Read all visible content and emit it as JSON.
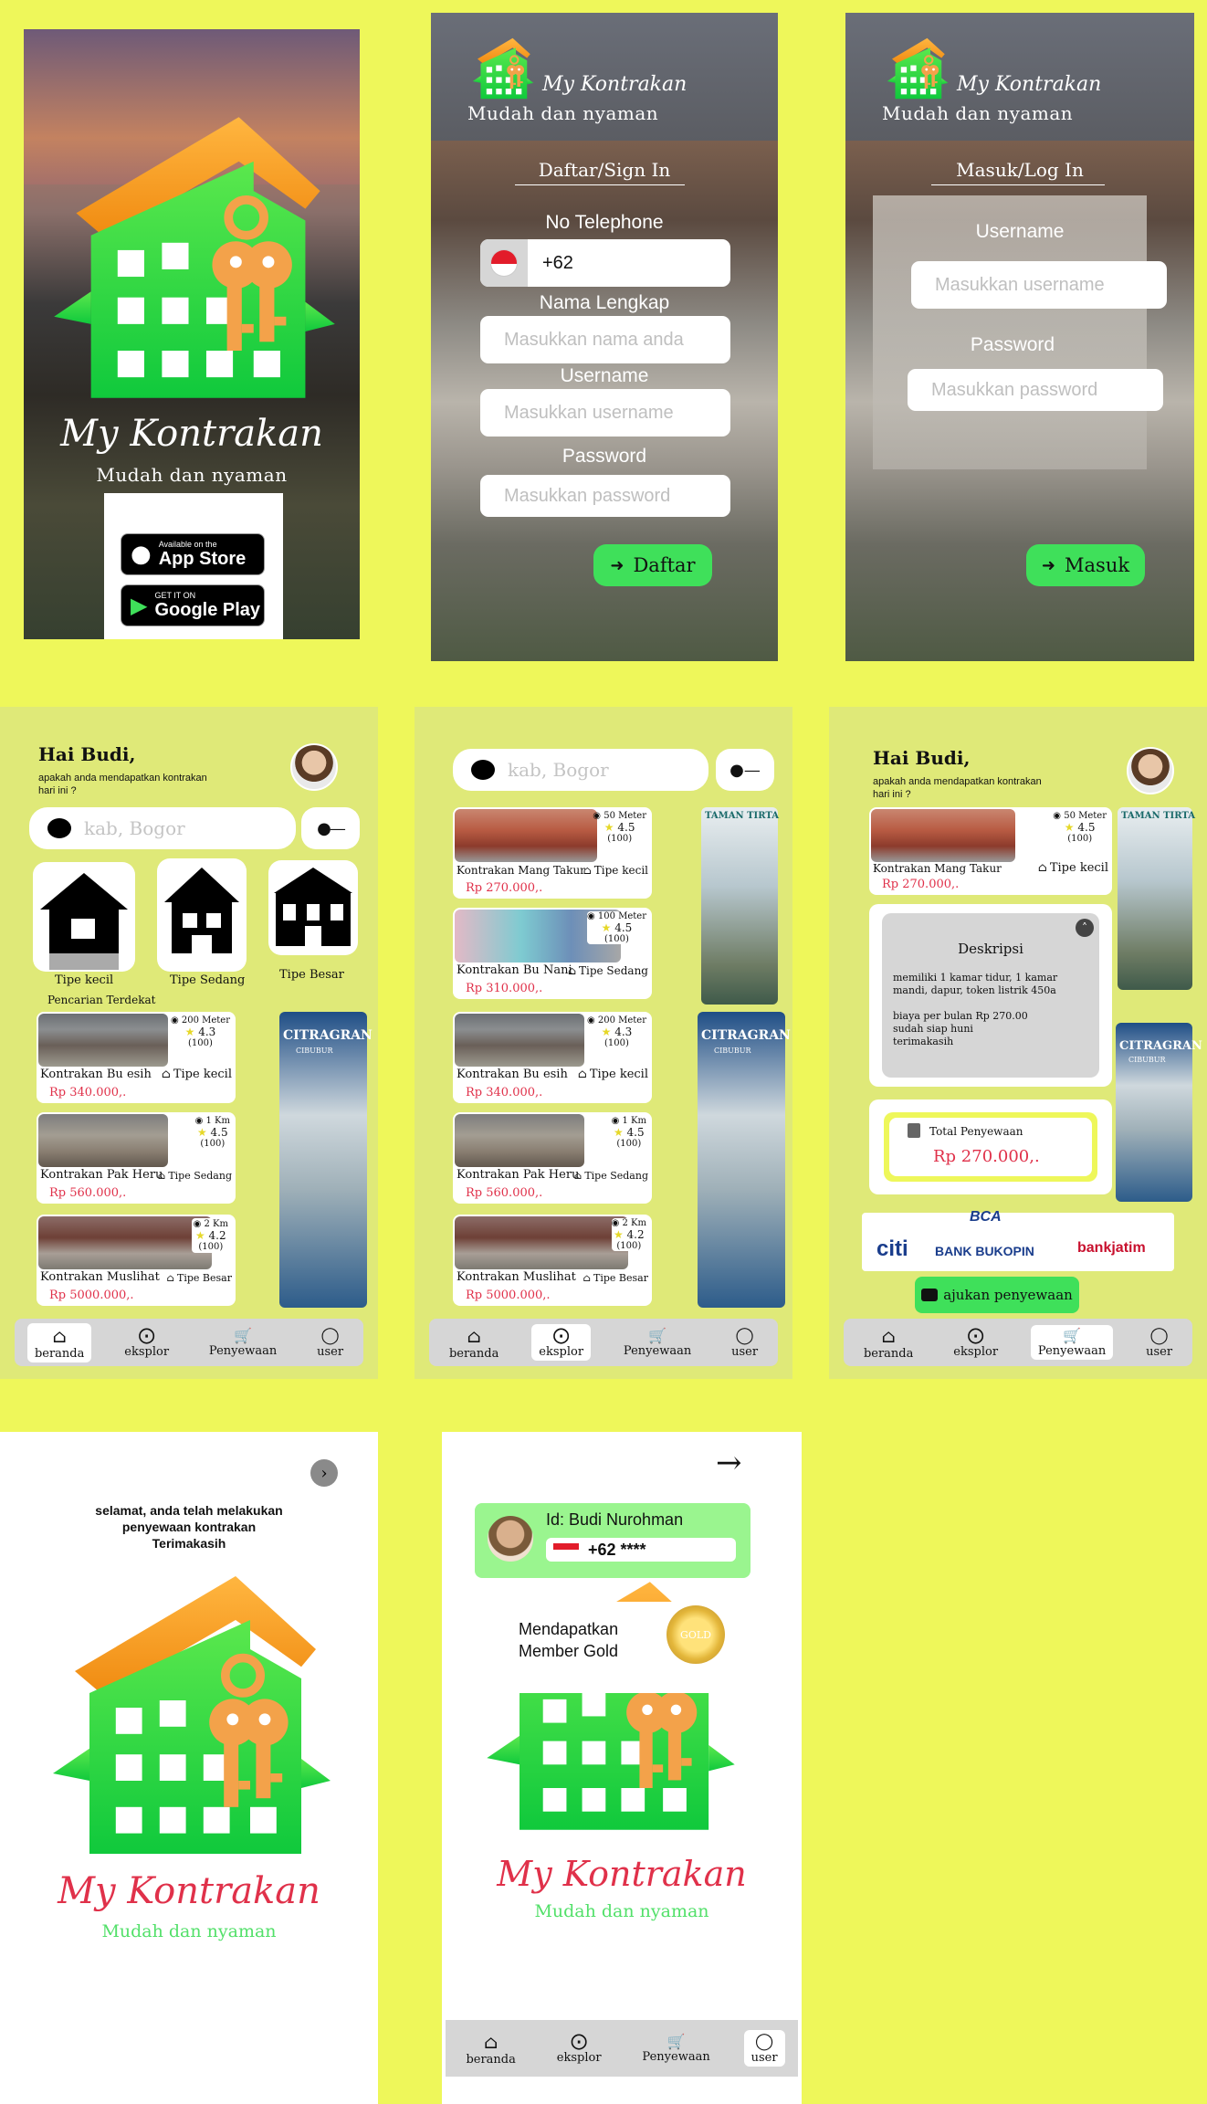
{
  "app": {
    "title": "My Kontrakan",
    "tagline": "Mudah dan nyaman"
  },
  "splash": {
    "appstore_small": "Available on the",
    "appstore_big": "App Store",
    "play_small": "GET IT ON",
    "play_big": "Google Play"
  },
  "register": {
    "heading": "Daftar/Sign In",
    "phone_label": "No Telephone",
    "phone_value": "+62",
    "name_label": "Nama Lengkap",
    "name_placeholder": "Masukkan nama anda",
    "username_label": "Username",
    "username_placeholder": "Masukkan username",
    "password_label": "Password",
    "password_placeholder": "Masukkan password",
    "button": "Daftar"
  },
  "login": {
    "heading": "Masuk/Log In",
    "username_label": "Username",
    "username_placeholder": "Masukkan username",
    "password_label": "Password",
    "password_placeholder": "Masukkan password",
    "button": "Masuk"
  },
  "home": {
    "greeting": "Hai Budi,",
    "question_1": "apakah anda mendapatkan kontrakan",
    "question_2": "hari ini ?",
    "search_placeholder": "kab, Bogor",
    "types": [
      "Tipe kecil",
      "Tipe Sedang",
      "Tipe Besar"
    ],
    "nearby_label": "Pencarian Terdekat"
  },
  "listings": [
    {
      "name": "Kontrakan  Bu esih",
      "price": "Rp 340.000,.",
      "type": "Tipe kecil",
      "distance": "200 Meter",
      "rating": "4.3",
      "reviews": "(100)"
    },
    {
      "name": "Kontrakan  Pak  Heru",
      "price": "Rp 560.000,.",
      "type": "Tipe Sedang",
      "distance": "1 Km",
      "rating": "4.5",
      "reviews": "(100)"
    },
    {
      "name": "Kontrakan  Muslihat",
      "price": "Rp 5000.000,.",
      "type": "Tipe Besar",
      "distance": "2 Km",
      "rating": "4.2",
      "reviews": "(100)"
    }
  ],
  "explore_extra": [
    {
      "name": "Kontrakan  Mang Takur",
      "price": "Rp 270.000,.",
      "type": "Tipe kecil",
      "distance": "50 Meter",
      "rating": "4.5",
      "reviews": "(100)"
    },
    {
      "name": "Kontrakan  Bu Nani",
      "price": "Rp 310.000,.",
      "type": "Tipe Sedang",
      "distance": "100 Meter",
      "rating": "4.5",
      "reviews": "(100)"
    }
  ],
  "banners": {
    "citra": "CITRAGRAN",
    "citra_sub": "CIBUBUR",
    "taman": "TAMAN TIRTA"
  },
  "detail": {
    "desc_title": "Deskripsi",
    "desc_1": "memiliki 1 kamar tidur, 1 kamar",
    "desc_2": "mandi, dapur, token listrik 450a",
    "desc_3": "biaya per bulan Rp 270.00",
    "desc_4": "sudah siap huni",
    "desc_5": "terimakasih",
    "total_label": "Total Penyewaan",
    "total_value": "Rp 270.000,.",
    "banks": [
      "citi",
      "BANK BUKOPIN",
      "bankjatim",
      "BCA"
    ],
    "submit": "ajukan penyewaan"
  },
  "nav": [
    "beranda",
    "eksplor",
    "Penyewaan",
    "user"
  ],
  "thanks": {
    "line1": "selamat, anda telah melakukan",
    "line2": "penyewaan kontrakan",
    "line3": "Terimakasih"
  },
  "profile": {
    "id_label": "Id: Budi Nurohman",
    "phone": "+62 ****",
    "member_1": "Mendapatkan",
    "member_2": "Member Gold",
    "badge": "GOLD"
  },
  "colors": {
    "page_bg": "#eef75a",
    "app_bg": "#dfe978",
    "green": "#3fe05a",
    "brand_green": "#1ec93a",
    "roof": "#f59a1a",
    "pink": "#e0314a"
  }
}
